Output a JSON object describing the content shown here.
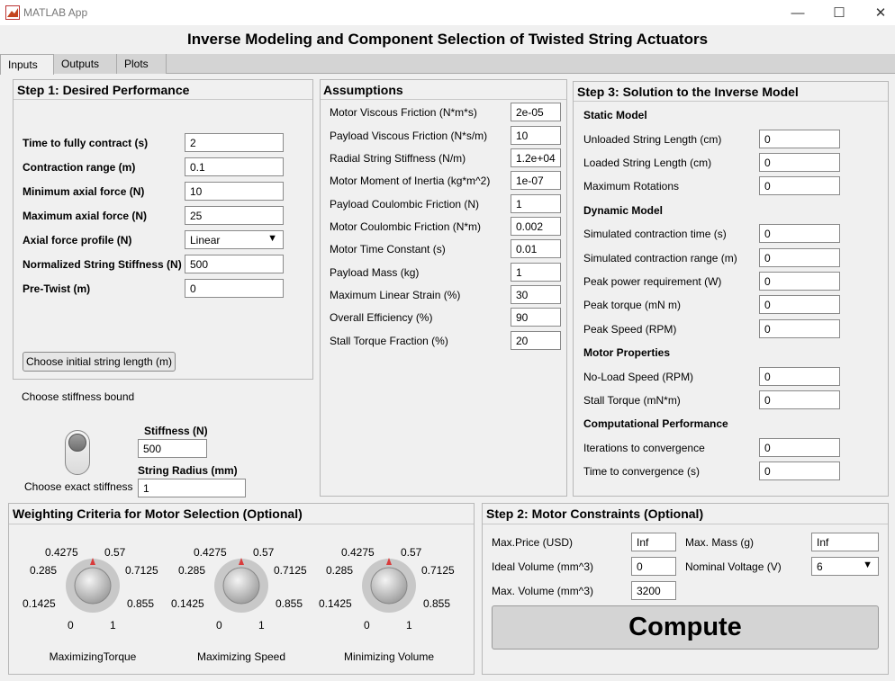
{
  "window": {
    "title": "MATLAB App",
    "minimize_glyph": "—",
    "maximize_glyph": "☐",
    "close_glyph": "✕"
  },
  "app_title": "Inverse Modeling and Component Selection of Twisted String Actuators",
  "tabs": [
    "Inputs",
    "Outputs",
    "Plots"
  ],
  "step1": {
    "title": "Step 1: Desired Performance",
    "fields": [
      {
        "label": "Time to fully contract (s)",
        "value": "2"
      },
      {
        "label": "Contraction range (m)",
        "value": "0.1"
      },
      {
        "label": "Minimum axial force (N)",
        "value": "10"
      },
      {
        "label": "Maximum axial force (N)",
        "value": "25"
      },
      {
        "label": "Axial force profile (N)",
        "value": "Linear",
        "dropdown": true
      },
      {
        "label": "Normalized String Stiffness (N)",
        "value": "500"
      },
      {
        "label": "Pre-Twist (m)",
        "value": "0"
      }
    ],
    "choose_length_button": "Choose initial string length (m)"
  },
  "stiffness": {
    "bound_label": "Choose stiffness bound",
    "exact_label": "Choose exact stiffness",
    "stiffness_label": "Stiffness (N)",
    "stiffness_value": "500",
    "radius_label": "String Radius (mm)",
    "radius_value": "1"
  },
  "assumptions": {
    "title": "Assumptions",
    "fields": [
      {
        "label": "Motor Viscous Friction (N*m*s)",
        "value": "2e-05"
      },
      {
        "label": "Payload Viscous Friction (N*s/m)",
        "value": "10"
      },
      {
        "label": "Radial String Stiffness (N/m)",
        "value": "1.2e+04"
      },
      {
        "label": "Motor Moment of Inertia (kg*m^2)",
        "value": "1e-07"
      },
      {
        "label": "Payload Coulombic Friction (N)",
        "value": "1"
      },
      {
        "label": "Motor Coulombic Friction (N*m)",
        "value": "0.002"
      },
      {
        "label": "Motor Time Constant (s)",
        "value": "0.01"
      },
      {
        "label": "Payload Mass (kg)",
        "value": "1"
      },
      {
        "label": "Maximum Linear Strain (%)",
        "value": "30"
      },
      {
        "label": "Overall Efficiency (%)",
        "value": "90"
      },
      {
        "label": "Stall Torque Fraction (%)",
        "value": "20"
      }
    ]
  },
  "step3": {
    "title": "Step 3: Solution to the Inverse Model",
    "sections": {
      "static": "Static Model",
      "dynamic": "Dynamic Model",
      "motor": "Motor Properties",
      "computational": "Computational Performance"
    },
    "static_fields": [
      {
        "label": "Unloaded String Length (cm)",
        "value": "0"
      },
      {
        "label": "Loaded String Length (cm)",
        "value": "0"
      },
      {
        "label": "Maximum Rotations",
        "value": "0"
      }
    ],
    "dynamic_fields": [
      {
        "label": "Simulated contraction time (s)",
        "value": "0"
      },
      {
        "label": "Simulated contraction range (m)",
        "value": "0"
      },
      {
        "label": "Peak power requirement (W)",
        "value": "0"
      },
      {
        "label": "Peak torque (mN m)",
        "value": "0"
      },
      {
        "label": "Peak Speed (RPM)",
        "value": "0"
      }
    ],
    "motor_fields": [
      {
        "label": "No-Load Speed (RPM)",
        "value": "0"
      },
      {
        "label": "Stall Torque (mN*m)",
        "value": "0"
      }
    ],
    "computational_fields": [
      {
        "label": "Iterations to convergence",
        "value": "0"
      },
      {
        "label": "Time to convergence (s)",
        "value": "0"
      }
    ]
  },
  "weighting": {
    "title": "Weighting Criteria for Motor Selection (Optional)",
    "tick_labels": [
      "0",
      "0.1425",
      "0.285",
      "0.4275",
      "0.57",
      "0.7125",
      "0.855",
      "1"
    ],
    "knobs": [
      {
        "caption": "MaximizingTorque",
        "value": 0.5
      },
      {
        "caption": "Maximizing Speed",
        "value": 0.5
      },
      {
        "caption": "Minimizing Volume",
        "value": 0.5
      }
    ]
  },
  "step2": {
    "title": "Step 2: Motor Constraints (Optional)",
    "max_price_label": "Max.Price (USD)",
    "max_price_value": "Inf",
    "max_mass_label": "Max. Mass (g)",
    "max_mass_value": "Inf",
    "ideal_volume_label": "Ideal Volume (mm^3)",
    "ideal_volume_value": "0",
    "nominal_voltage_label": "Nominal Voltage (V)",
    "nominal_voltage_value": "6",
    "max_volume_label": "Max. Volume (mm^3)",
    "max_volume_value": "3200",
    "compute_label": "Compute"
  },
  "colors": {
    "pointer": "#d93b3b",
    "panel_border": "#b8b8b8",
    "background": "#f0f0f0"
  }
}
